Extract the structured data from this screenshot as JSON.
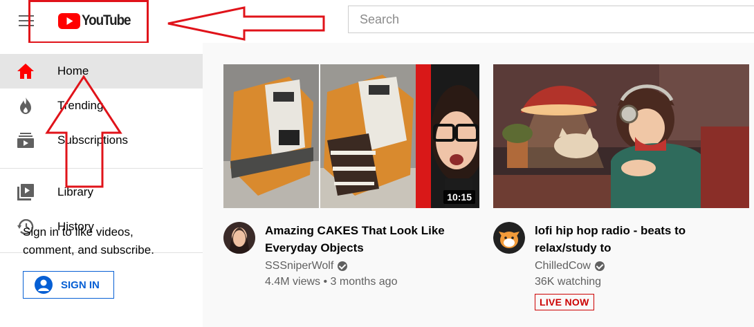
{
  "header": {
    "logo_text": "YouTube",
    "search_placeholder": "Search"
  },
  "sidebar": {
    "items": [
      {
        "label": "Home",
        "icon": "home-icon",
        "active": true
      },
      {
        "label": "Trending",
        "icon": "flame-icon",
        "active": false
      },
      {
        "label": "Subscriptions",
        "icon": "subscriptions-icon",
        "active": false
      },
      {
        "label": "Library",
        "icon": "library-icon",
        "active": false
      },
      {
        "label": "History",
        "icon": "history-icon",
        "active": false
      }
    ],
    "signin_text": "Sign in to like videos, comment, and subscribe.",
    "signin_button": "SIGN IN"
  },
  "videos": [
    {
      "title": "Amazing CAKES That Look Like Everyday Objects",
      "channel": "SSSniperWolf",
      "verified": true,
      "stats": "4.4M views • 3 months ago",
      "duration": "10:15"
    },
    {
      "title": "lofi hip hop radio - beats to relax/study to",
      "channel": "ChilledCow",
      "verified": true,
      "stats": "36K watching",
      "badge": "LIVE NOW"
    }
  ],
  "colors": {
    "brand_red": "#ff0000",
    "annotation_red": "#e0131a",
    "link_blue": "#065fd4",
    "live_red": "#cc0000"
  }
}
